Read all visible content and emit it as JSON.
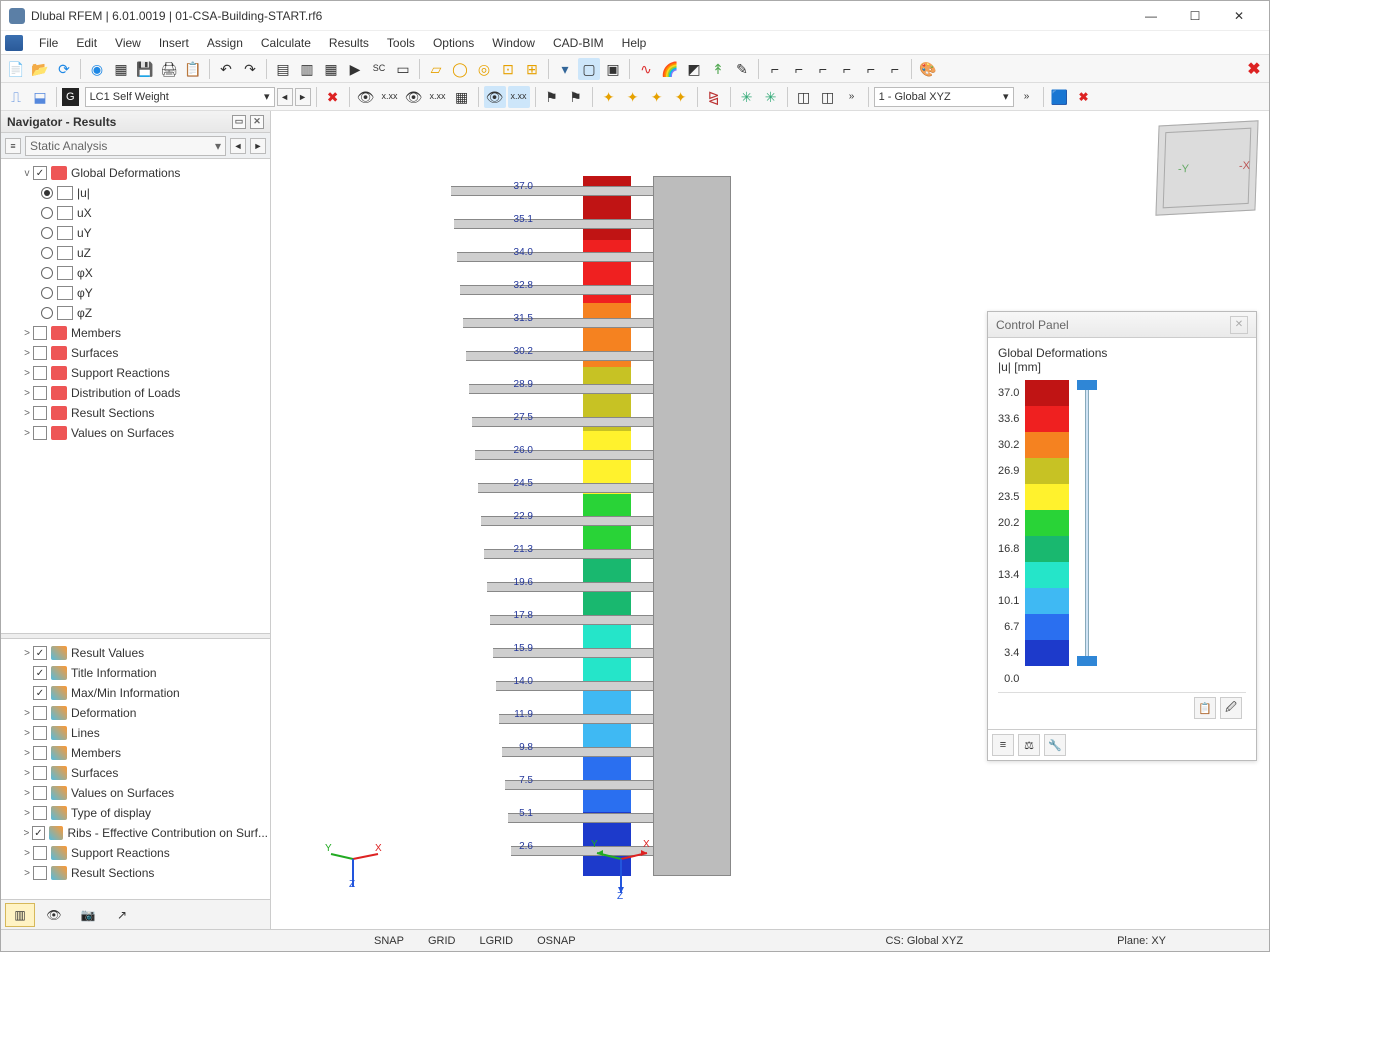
{
  "title": "Dlubal RFEM | 6.01.0019 | 01-CSA-Building-START.rf6",
  "menu": [
    "File",
    "Edit",
    "View",
    "Insert",
    "Assign",
    "Calculate",
    "Results",
    "Tools",
    "Options",
    "Window",
    "CAD-BIM",
    "Help"
  ],
  "load_tag": "G",
  "load_case": "LC1   Self Weight",
  "coord_system_dd": "1 - Global XYZ",
  "nav": {
    "title": "Navigator - Results",
    "subtitle": "Static Analysis",
    "top_tree": [
      {
        "exp": "v",
        "cb": true,
        "label": "Global Deformations",
        "indent": 0,
        "radio": false
      },
      {
        "radio": true,
        "sel": true,
        "label": "|u|",
        "indent": 2
      },
      {
        "radio": true,
        "sel": false,
        "label": "uX",
        "indent": 2
      },
      {
        "radio": true,
        "sel": false,
        "label": "uY",
        "indent": 2
      },
      {
        "radio": true,
        "sel": false,
        "label": "uZ",
        "indent": 2
      },
      {
        "radio": true,
        "sel": false,
        "label": "φX",
        "indent": 2
      },
      {
        "radio": true,
        "sel": false,
        "label": "φY",
        "indent": 2
      },
      {
        "radio": true,
        "sel": false,
        "label": "φZ",
        "indent": 2
      },
      {
        "exp": ">",
        "cb": false,
        "label": "Members",
        "indent": 0
      },
      {
        "exp": ">",
        "cb": false,
        "label": "Surfaces",
        "indent": 0
      },
      {
        "exp": ">",
        "cb": false,
        "label": "Support Reactions",
        "indent": 0
      },
      {
        "exp": ">",
        "cb": false,
        "label": "Distribution of Loads",
        "indent": 0
      },
      {
        "exp": ">",
        "cb": false,
        "label": "Result Sections",
        "indent": 0
      },
      {
        "exp": ">",
        "cb": false,
        "label": "Values on Surfaces",
        "indent": 0
      }
    ],
    "bottom_tree": [
      {
        "exp": ">",
        "cb": true,
        "label": "Result Values"
      },
      {
        "exp": "",
        "cb": true,
        "label": "Title Information"
      },
      {
        "exp": "",
        "cb": true,
        "label": "Max/Min Information"
      },
      {
        "exp": ">",
        "cb": false,
        "label": "Deformation"
      },
      {
        "exp": ">",
        "cb": false,
        "label": "Lines"
      },
      {
        "exp": ">",
        "cb": false,
        "label": "Members"
      },
      {
        "exp": ">",
        "cb": false,
        "label": "Surfaces"
      },
      {
        "exp": ">",
        "cb": false,
        "label": "Values on Surfaces"
      },
      {
        "exp": ">",
        "cb": false,
        "label": "Type of display"
      },
      {
        "exp": ">",
        "cb": true,
        "label": "Ribs - Effective Contribution on Surf..."
      },
      {
        "exp": ">",
        "cb": false,
        "label": "Support Reactions"
      },
      {
        "exp": ">",
        "cb": false,
        "label": "Result Sections"
      }
    ]
  },
  "control_panel": {
    "title": "Control Panel",
    "heading": "Global Deformations",
    "unit": "|u| [mm]",
    "legend": [
      {
        "v": "37.0",
        "c": "#c01414"
      },
      {
        "v": "33.6",
        "c": "#ef2020"
      },
      {
        "v": "30.2",
        "c": "#f58220"
      },
      {
        "v": "26.9",
        "c": "#c7c224"
      },
      {
        "v": "23.5",
        "c": "#fff22d"
      },
      {
        "v": "20.2",
        "c": "#29d337"
      },
      {
        "v": "16.8",
        "c": "#19b86f"
      },
      {
        "v": "13.4",
        "c": "#25e5c9"
      },
      {
        "v": "10.1",
        "c": "#3fb9f3"
      },
      {
        "v": "6.7",
        "c": "#2a6ff0"
      },
      {
        "v": "3.4",
        "c": "#1d3acb"
      },
      {
        "v": "0.0",
        "c": "#0e1f7b"
      }
    ]
  },
  "model_values": [
    "37.0",
    "35.1",
    "34.0",
    "32.8",
    "31.5",
    "30.2",
    "28.9",
    "27.5",
    "26.0",
    "24.5",
    "22.9",
    "21.3",
    "19.6",
    "17.8",
    "15.9",
    "14.0",
    "11.9",
    "9.8",
    "7.5",
    "5.1",
    "2.6"
  ],
  "axis_big": {
    "x": "X",
    "y": "Y",
    "z": "Z"
  },
  "axis_small": {
    "x": "X",
    "y": "Y",
    "z": "Z"
  },
  "status": {
    "snap": "SNAP",
    "grid": "GRID",
    "lgrid": "LGRID",
    "osnap": "OSNAP",
    "cs": "CS: Global XYZ",
    "plane": "Plane: XY"
  }
}
